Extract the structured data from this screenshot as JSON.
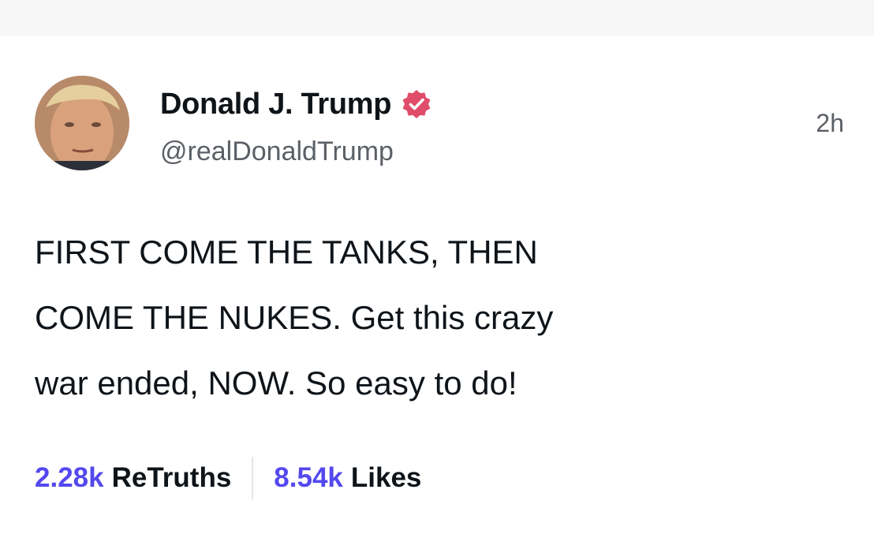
{
  "post": {
    "author": {
      "display_name": "Donald J. Trump",
      "handle": "@realDonaldTrump",
      "verified": true,
      "verified_badge_color": "#e04d6a"
    },
    "timestamp": "2h",
    "text": "FIRST COME THE TANKS, THEN\nCOME THE NUKES. Get this crazy\nwar ended, NOW. So easy to do!",
    "stats": {
      "retruths_count": "2.28k",
      "retruths_label": "ReTruths",
      "likes_count": "8.54k",
      "likes_label": "Likes"
    }
  },
  "colors": {
    "accent": "#5448ee",
    "text_primary": "#0f1419",
    "text_secondary": "#5b6066"
  }
}
